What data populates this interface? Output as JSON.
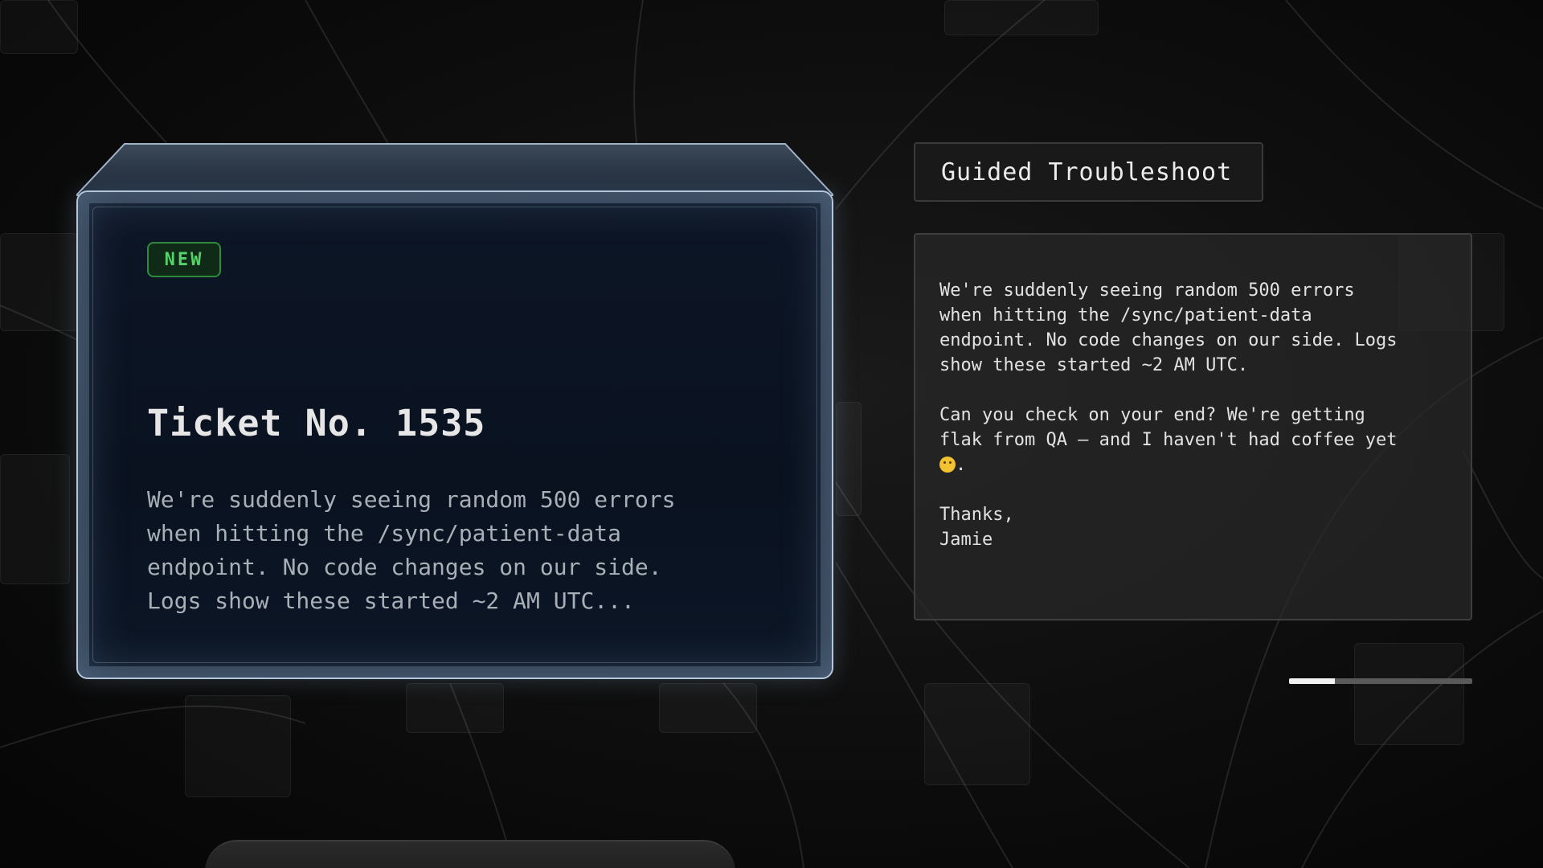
{
  "ticket": {
    "badge": "NEW",
    "title": "Ticket No. 1535",
    "preview": "We're suddenly seeing random 500 errors\nwhen hitting the /sync/patient-data\nendpoint. No code changes on our side.\nLogs show these started ~2 AM UTC..."
  },
  "guided_button": {
    "label": "Guided Troubleshoot"
  },
  "message": {
    "paragraph1": "We're suddenly seeing random 500 errors\nwhen hitting the /sync/patient-data\nendpoint. No code changes on our side. Logs\nshow these started ~2 AM UTC.",
    "paragraph2": "Can you check on your end? We're getting\nflak from QA — and I haven't had coffee yet",
    "paragraph2_end": ".",
    "emoji_icon": "grinning-face-icon",
    "signoff": "Thanks,",
    "signature": "Jamie"
  },
  "progress": {
    "fraction": 0.25
  },
  "colors": {
    "badge_green": "#56d26a",
    "glass_edge": "#b4c6da",
    "progress_fill": "#f2f2f2"
  }
}
